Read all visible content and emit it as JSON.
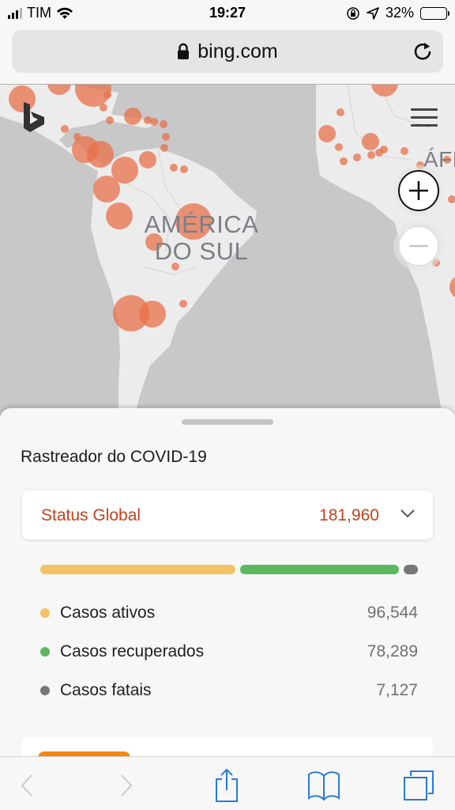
{
  "status_bar": {
    "carrier": "TIM",
    "time": "19:27",
    "battery_percent": "32%",
    "battery_level": 0.32,
    "icons": [
      "signal-icon",
      "wifi-icon",
      "orientation-lock-icon",
      "location-icon",
      "battery-icon"
    ]
  },
  "browser": {
    "url": "bing.com",
    "secure_icon": "lock-icon",
    "reload_icon": "reload-icon"
  },
  "map": {
    "labels": {
      "south_america_line1": "AMÉRICA",
      "south_america_line2": "DO SUL",
      "africa_partial": "ÁFR"
    },
    "logo": "bing-logo",
    "menu_icon": "hamburger-menu-icon",
    "zoom_in_label": "+",
    "zoom_out_label": "−",
    "marker_color": "#e8704a"
  },
  "tracker": {
    "title": "Rastreador do COVID-19",
    "status_label": "Status Global",
    "status_total": "181,960",
    "expand_icon": "chevron-down-icon",
    "accent_color": "#c8401b",
    "breakdown": [
      {
        "label": "Casos ativos",
        "value": "96,544",
        "count": 96544,
        "color": "#f3c262"
      },
      {
        "label": "Casos recuperados",
        "value": "78,289",
        "count": 78289,
        "color": "#5cb85f"
      },
      {
        "label": "Casos fatais",
        "value": "7,127",
        "count": 7127,
        "color": "#767676"
      }
    ]
  },
  "toolbar": {
    "items": [
      {
        "name": "back-button",
        "icon": "chevron-left-icon",
        "enabled": false
      },
      {
        "name": "forward-button",
        "icon": "chevron-right-icon",
        "enabled": false
      },
      {
        "name": "share-button",
        "icon": "share-icon",
        "enabled": true
      },
      {
        "name": "bookmarks-button",
        "icon": "book-icon",
        "enabled": true
      },
      {
        "name": "tabs-button",
        "icon": "tabs-icon",
        "enabled": true
      }
    ],
    "tint_color": "#2a7bd4"
  }
}
